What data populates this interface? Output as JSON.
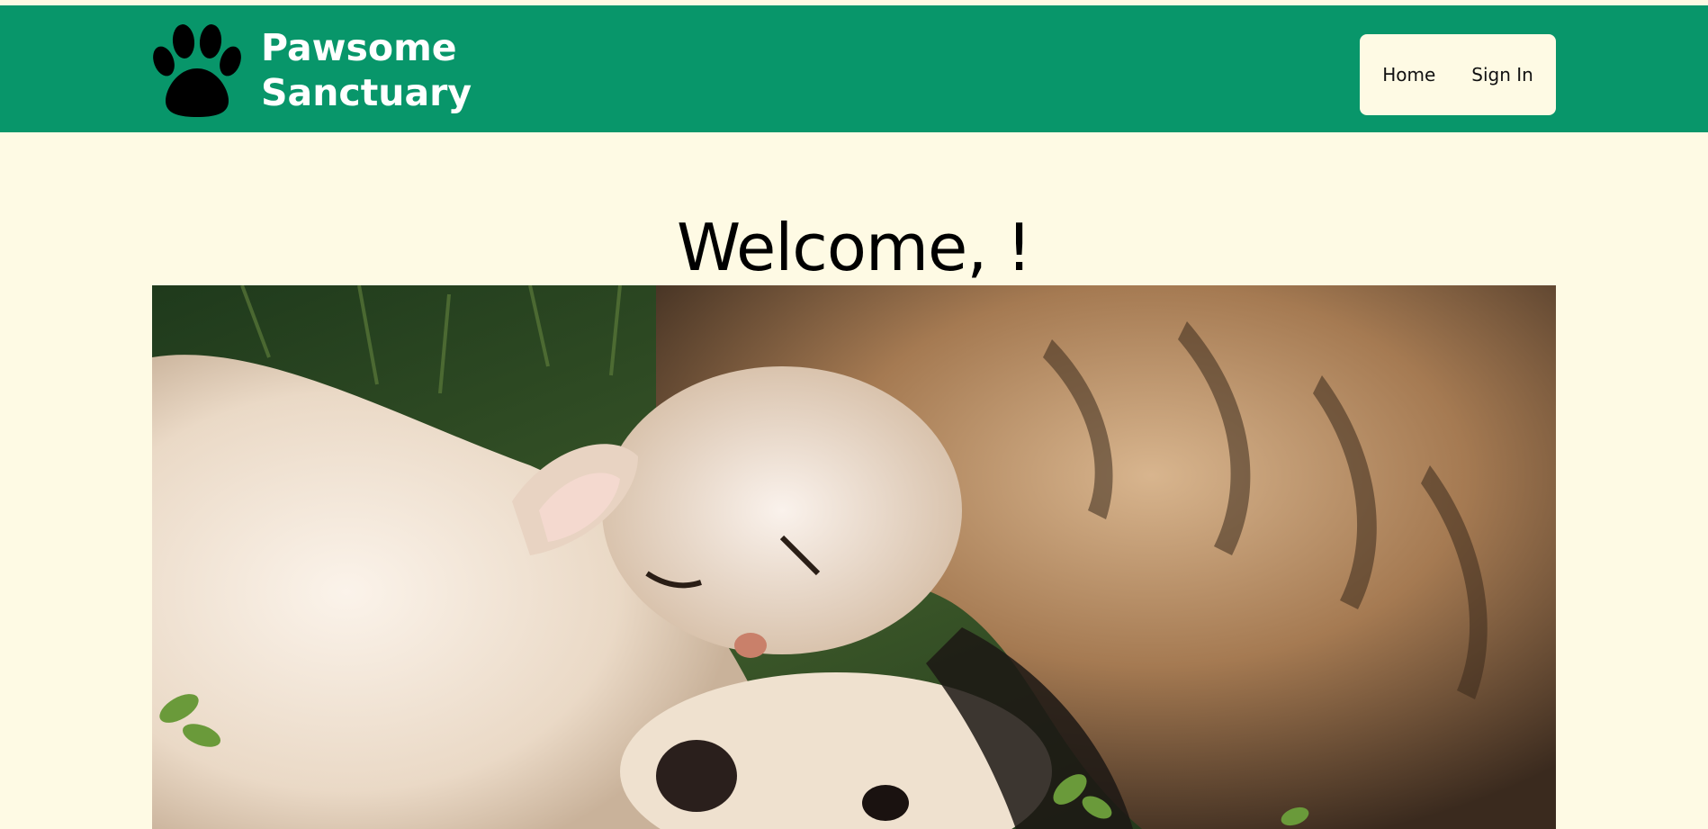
{
  "header": {
    "brand_line1": "Pawsome",
    "brand_line2": "Sanctuary",
    "logo_icon": "paw-icon",
    "bg_color": "#08966a"
  },
  "nav": {
    "items": [
      {
        "label": "Home"
      },
      {
        "label": "Sign In"
      }
    ]
  },
  "main": {
    "welcome_prefix": "Welcome,",
    "welcome_name": "",
    "welcome_suffix": "!"
  },
  "hero": {
    "alt": "cat-and-dog-photo"
  },
  "colors": {
    "page_bg": "#fefae4",
    "accent": "#08966a"
  }
}
